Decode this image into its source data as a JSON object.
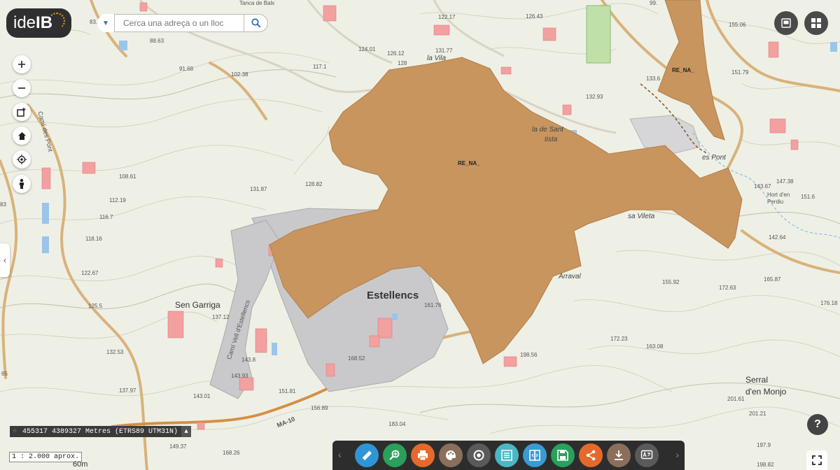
{
  "app": {
    "logo_text_a": "ide",
    "logo_text_b": "IB"
  },
  "search": {
    "placeholder": "Cerca una adreça o un lloc"
  },
  "map_controls": [
    {
      "name": "zoom-in-button",
      "icon": "plus-icon"
    },
    {
      "name": "zoom-out-button",
      "icon": "minus-icon"
    },
    {
      "name": "add-layer-button",
      "icon": "add-layer-icon"
    },
    {
      "name": "home-button",
      "icon": "home-icon"
    },
    {
      "name": "locate-button",
      "icon": "target-icon"
    },
    {
      "name": "streetview-button",
      "icon": "person-icon"
    }
  ],
  "top_right": [
    {
      "name": "basemap-button",
      "icon": "map-icon"
    },
    {
      "name": "layers-grid-button",
      "icon": "grid-icon"
    }
  ],
  "status": {
    "coordinates": "455317 4389327 Metres (ETRS89 UTM31N)",
    "scale": "1 : 2.000 aprox.",
    "scalebar": "60m"
  },
  "toolbar": {
    "tools": [
      {
        "name": "measure-tool",
        "icon": "ruler-icon",
        "color": "#2f95d6"
      },
      {
        "name": "zoom-area-tool",
        "icon": "magnifier-plus-icon",
        "color": "#2aa05a"
      },
      {
        "name": "print-tool",
        "icon": "printer-icon",
        "color": "#e4692c"
      },
      {
        "name": "style-tool",
        "icon": "palette-icon",
        "color": "#8b6f5c"
      },
      {
        "name": "draw-point-tool",
        "icon": "target-icon",
        "color": "#5a5a5a"
      },
      {
        "name": "table-tool",
        "icon": "list-icon",
        "color": "#4bb7c4"
      },
      {
        "name": "compare-tool",
        "icon": "split-icon",
        "color": "#3c9ad0"
      },
      {
        "name": "save-tool",
        "icon": "floppy-icon",
        "color": "#2aa05a"
      },
      {
        "name": "share-tool",
        "icon": "share-icon",
        "color": "#e4692c"
      },
      {
        "name": "download-tool",
        "icon": "download-icon",
        "color": "#8b6f5c"
      },
      {
        "name": "translate-tool",
        "icon": "translate-icon",
        "color": "#5a5a5a"
      }
    ]
  },
  "map_labels": {
    "places": [
      "Estellencs",
      "Sen Garriga",
      "Serral",
      "d'en Monjo",
      "la Vila",
      "sa Vileta",
      "Arraval",
      "es Pont",
      "Hort d'en",
      "Perdiu",
      "la de Sant",
      "tista",
      "Camí des Pont",
      "Camí Vell d'Estellencs",
      "MA-10",
      "Tanca de Balx"
    ],
    "overlay_labels": [
      "RE_NA_",
      "RE_NA_"
    ],
    "spot_heights": [
      "88.63",
      "91.68",
      "102.38",
      "122.17",
      "126.43",
      "124.01",
      "126.12",
      "128",
      "131.77",
      "117.1",
      "132.93",
      "133.6",
      "155.06",
      "151.79",
      "131.87",
      "128.82",
      "108.61",
      "112.19",
      "116.7",
      "118.16",
      "122.67",
      "125.5",
      "137.12",
      "132.53",
      "137.97",
      "143.8",
      "143.93",
      "143.01",
      "151.81",
      "156.89",
      "161.76",
      "168.52",
      "172.23",
      "163.08",
      "155.92",
      "172.63",
      "165.87",
      "147.38",
      "143.67",
      "151.6",
      "142.64",
      "198.56",
      "201.61",
      "201.21",
      "197.9",
      "198.82",
      "183.04",
      "149.37",
      "168.26",
      "83.",
      "83",
      "65",
      "176.18",
      "99."
    ]
  },
  "colors": {
    "overlay": "#c8955f",
    "urban": "#c9c9cb",
    "building": "#f2a0a0",
    "road": "#e1b681",
    "contour": "#c9c5b4",
    "water": "#9bc5ea"
  }
}
